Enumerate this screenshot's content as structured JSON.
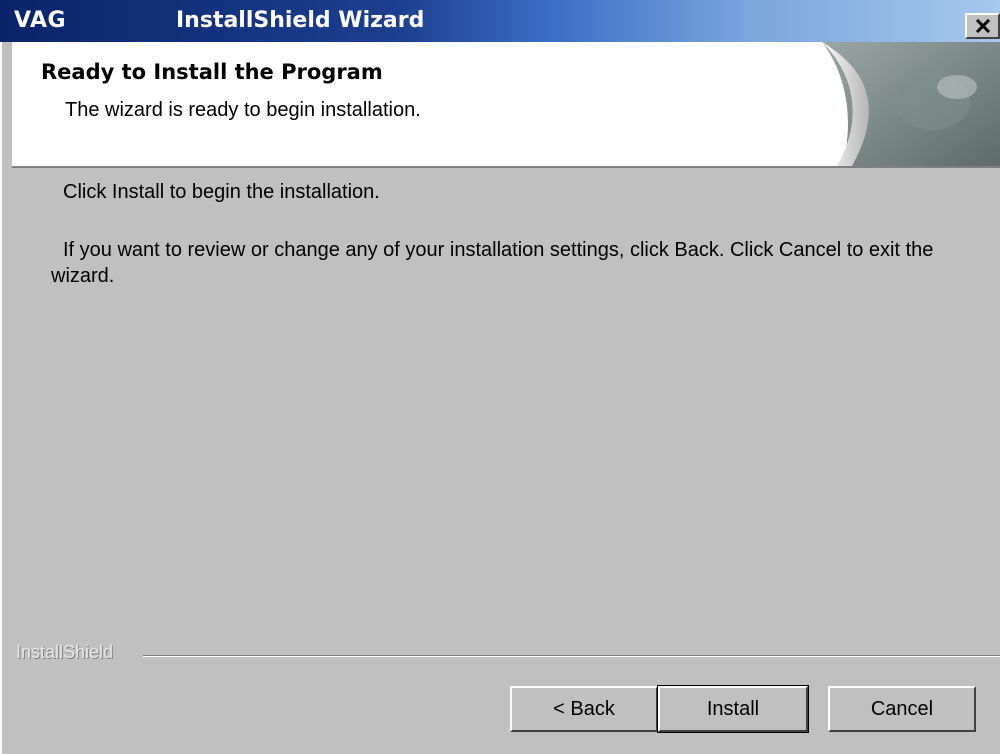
{
  "window": {
    "app_name": "VAG",
    "title": "InstallShield Wizard",
    "close_glyph": "✕"
  },
  "header": {
    "title": "Ready to Install the Program",
    "subtitle": "The wizard is ready to begin installation."
  },
  "body": {
    "line1": "Click Install to begin the installation.",
    "line2": "If you want to review or change any of your installation settings, click Back. Click Cancel to exit the wizard."
  },
  "footer": {
    "brand": "InstallShield",
    "buttons": {
      "back": "< Back",
      "install": "Install",
      "cancel": "Cancel"
    }
  },
  "icons": {
    "close": "close-icon",
    "header_art": "page-curl-graphic"
  },
  "colors": {
    "titlebar_start": "#0a246a",
    "titlebar_end": "#a6c8ee",
    "dialog_bg": "#c0c0c0",
    "header_bg": "#ffffff"
  }
}
